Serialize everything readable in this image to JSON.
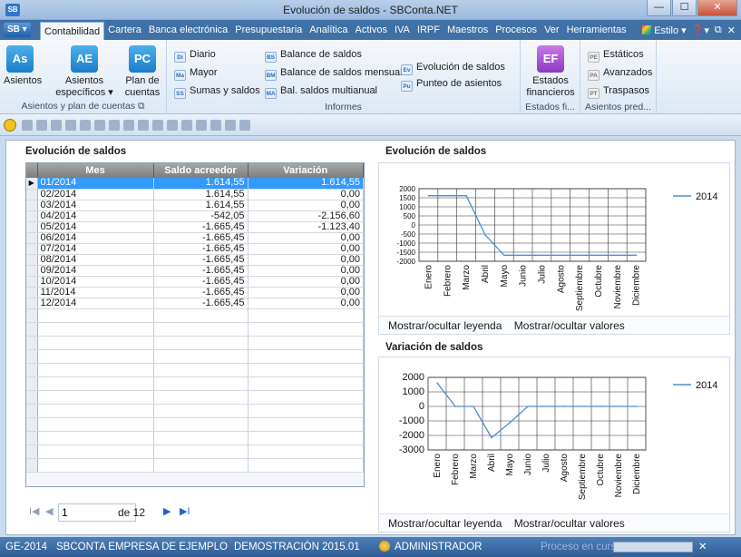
{
  "window": {
    "logo": "SB",
    "title": "Evolución de saldos - SBConta.NET",
    "buttons": {
      "minimize": "—",
      "maximize": "☐",
      "close": "✕"
    }
  },
  "menubar": {
    "app_menu": "SB ▾",
    "tabs": [
      "Contabilidad",
      "Cartera",
      "Banca electrónica",
      "Presupuestaria",
      "Analítica",
      "Activos",
      "IVA",
      "IRPF",
      "Maestros",
      "Procesos",
      "Ver",
      "Herramientas"
    ],
    "active_tab": "Contabilidad",
    "estilo": "Estilo ▾",
    "help": "❓▾",
    "restore": "⧉",
    "close": "✕"
  },
  "ribbon": {
    "groups": {
      "asientos_plan": {
        "label": "Asientos y plan de cuentas",
        "asientos": {
          "icon": "As",
          "label": "Asientos"
        },
        "asientos_especificos": {
          "icon": "AE",
          "label1": "Asientos",
          "label2": "específicos ▾"
        },
        "plan_cuentas": {
          "icon": "PC",
          "label1": "Plan de",
          "label2": "cuentas"
        }
      },
      "informes": {
        "label": "Informes",
        "diario": {
          "icon": "Di",
          "label": "Diario"
        },
        "mayor": {
          "icon": "Ma",
          "label": "Mayor"
        },
        "sumas_saldos": {
          "icon": "SS",
          "label": "Sumas y saldos"
        },
        "balance_saldos": {
          "icon": "BS",
          "label": "Balance de saldos"
        },
        "balance_mensual": {
          "icon": "BM",
          "label": "Balance de saldos mensual"
        },
        "bal_multianual": {
          "icon": "MA",
          "label": "Bal. saldos multianual"
        },
        "evolucion_saldos": {
          "icon": "Ev",
          "label": "Evolución de saldos"
        },
        "punteo_asientos": {
          "icon": "Pu",
          "label": "Punteo de asientos"
        }
      },
      "estados": {
        "label": "Estados fi...",
        "estados_financieros": {
          "icon": "EF",
          "label1": "Estados",
          "label2": "financieros"
        }
      },
      "asientos_pred": {
        "label": "Asientos pred...",
        "estaticos": {
          "icon": "PE",
          "label": "Estáticos"
        },
        "avanzados": {
          "icon": "PA",
          "label": "Avanzados"
        },
        "traspasos": {
          "icon": "PT",
          "label": "Traspasos"
        }
      }
    }
  },
  "grid": {
    "title": "Evolución de saldos",
    "columns": [
      "Mes",
      "Saldo acreedor",
      "Variación"
    ],
    "rows": [
      [
        "01/2014",
        "1.614,55",
        "1.614,55"
      ],
      [
        "02/2014",
        "1.614,55",
        "0,00"
      ],
      [
        "03/2014",
        "1.614,55",
        "0,00"
      ],
      [
        "04/2014",
        "-542,05",
        "-2.156,60"
      ],
      [
        "05/2014",
        "-1.665,45",
        "-1.123,40"
      ],
      [
        "06/2014",
        "-1.665,45",
        "0,00"
      ],
      [
        "07/2014",
        "-1.665,45",
        "0,00"
      ],
      [
        "08/2014",
        "-1.665,45",
        "0,00"
      ],
      [
        "09/2014",
        "-1.665,45",
        "0,00"
      ],
      [
        "10/2014",
        "-1.665,45",
        "0,00"
      ],
      [
        "11/2014",
        "-1.665,45",
        "0,00"
      ],
      [
        "12/2014",
        "-1.665,45",
        "0,00"
      ]
    ],
    "selected_row": 0,
    "pager": {
      "first": "I◀",
      "prev": "◀",
      "page": "1",
      "of": "de 12",
      "next": "▶",
      "last": "▶I"
    }
  },
  "chart_links": {
    "legend": "Mostrar/ocultar leyenda",
    "values": "Mostrar/ocultar valores"
  },
  "chart_data": [
    {
      "type": "line",
      "title": "Evolución de saldos",
      "categories": [
        "Enero",
        "Febrero",
        "Marzo",
        "Abril",
        "Mayo",
        "Junio",
        "Julio",
        "Agosto",
        "Septiembre",
        "Octubre",
        "Noviembre",
        "Diciembre"
      ],
      "series": [
        {
          "name": "2014",
          "values": [
            1614.55,
            1614.55,
            1614.55,
            -542.05,
            -1665.45,
            -1665.45,
            -1665.45,
            -1665.45,
            -1665.45,
            -1665.45,
            -1665.45,
            -1665.45
          ]
        }
      ],
      "ylim": [
        -2000,
        2000
      ],
      "yticks": [
        2000,
        1500,
        1000,
        500,
        0,
        -500,
        -1000,
        -1500,
        -2000
      ],
      "grid": true,
      "legend": "top-right",
      "color": "#4a8fd6"
    },
    {
      "type": "line",
      "title": "Variación de saldos",
      "categories": [
        "Enero",
        "Febrero",
        "Marzo",
        "Abril",
        "Mayo",
        "Junio",
        "Julio",
        "Agosto",
        "Septiembre",
        "Octubre",
        "Noviembre",
        "Diciembre"
      ],
      "series": [
        {
          "name": "2014",
          "values": [
            1614.55,
            0,
            0,
            -2156.6,
            -1123.4,
            0,
            0,
            0,
            0,
            0,
            0,
            0
          ]
        }
      ],
      "ylim": [
        -3000,
        2000
      ],
      "yticks": [
        2000,
        1000,
        0,
        -1000,
        -2000,
        -3000
      ],
      "grid": true,
      "legend": "top-right",
      "color": "#4a8fd6"
    }
  ],
  "statusbar": {
    "company": "GE-2014",
    "company_name": "SBCONTA EMPRESA DE EJEMPLO",
    "version": "DEMOSTRACIÓN 2015.01",
    "user": "ADMINISTRADOR",
    "process": "Proceso en curso",
    "close": "✕"
  }
}
